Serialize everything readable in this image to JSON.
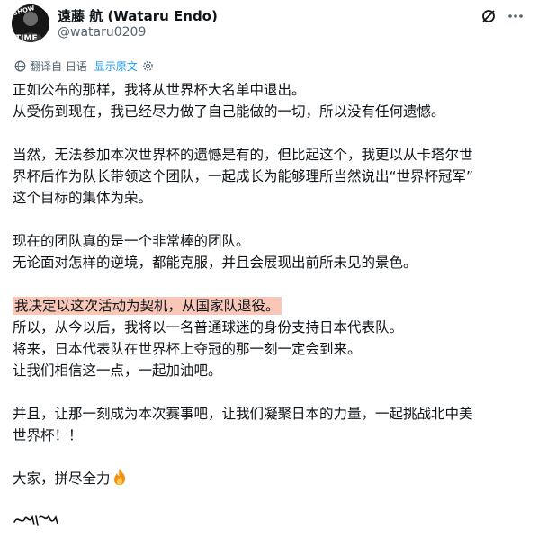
{
  "author": {
    "name": "遠藤 航 (Wataru Endo)",
    "handle": "@wataru0209",
    "avatar_text": "SHOW TIME"
  },
  "header_icons": {
    "grok": "grok-icon",
    "more": "more-options-icon"
  },
  "translation": {
    "translated_from": "翻译自 日语",
    "show_original": "显示原文",
    "globe_icon": "globe-icon",
    "settings_icon": "gear-icon"
  },
  "post": {
    "p1_l1": "正如公布的那样，我将从世界杯大名单中退出。",
    "p1_l2": "从受伤到现在，我已经尽力做了自己能做的一切，所以没有任何遗憾。",
    "p2_l1": "当然，无法参加本次世界杯的遗憾是有的，但比起这个，我更以从卡塔尔世",
    "p2_l2": "界杯后作为队长带领这个团队，一起成长为能够理所当然说出“世界杯冠军”",
    "p2_l3": "这个目标的集体为荣。",
    "p3_l1": "现在的团队真的是一个非常棒的团队。",
    "p3_l2": "无论面对怎样的逆境，都能克服，并且会展现出前所未见的景色。",
    "p4_l1": "我决定以这次活动为契机，从国家队退役。",
    "p4_l2": "所以，从今以后，我将以一名普通球迷的身份支持日本代表队。",
    "p4_l3": "将来，日本代表队在世界杯上夺冠的那一刻一定会到来。",
    "p4_l4": "让我们相信这一点，一起加油吧。",
    "p5_l1": "并且，让那一刻成为本次赛事吧，让我们凝聚日本的力量，一起挑战北中美",
    "p5_l2": "世界杯！！",
    "p6_l1": "大家，拼尽全力",
    "emoji": "fire-emoji",
    "highlight_color": "#f8c7b8",
    "signature": "signature-image"
  },
  "colors": {
    "text": "#0f1419",
    "secondary": "#536471",
    "link": "#1d9bf0"
  }
}
